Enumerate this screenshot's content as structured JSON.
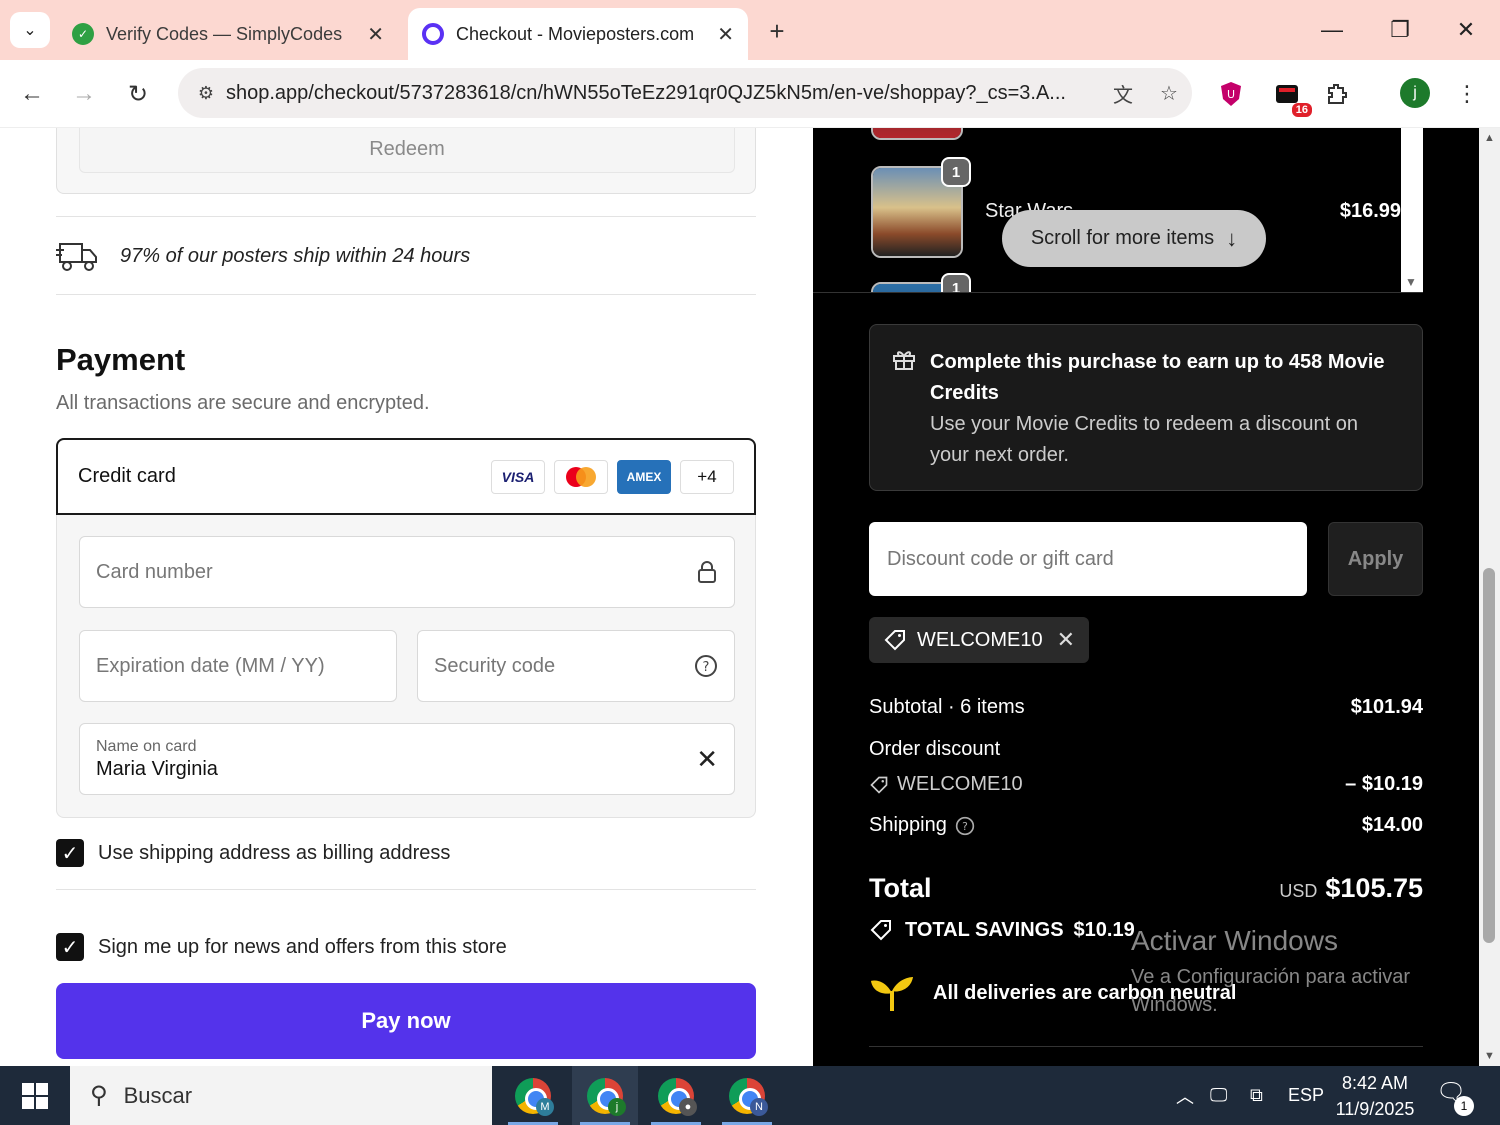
{
  "browser": {
    "tabs": [
      {
        "title": "Verify Codes — SimplyCodes",
        "active": false,
        "favicon": "simplycodes-icon"
      },
      {
        "title": "Checkout - Movieposters.com",
        "active": true,
        "favicon": "shop-icon"
      }
    ],
    "url": "shop.app/checkout/5737283618/cn/hWN55oTeEz291qr0QJZ5kN5m/en-ve/shoppay?_cs=3.A...",
    "extension_badge": "16",
    "profile_initial": "j"
  },
  "checkout": {
    "redeem_label": "Redeem",
    "shipping_note": "97% of our posters ship within 24 hours",
    "payment": {
      "title": "Payment",
      "subtitle": "All transactions are secure and encrypted.",
      "method_label": "Credit card",
      "card_brands": [
        "VISA",
        "",
        "AMEX",
        "+4"
      ],
      "card_number_placeholder": "Card number",
      "expiration_placeholder": "Expiration date (MM / YY)",
      "security_placeholder": "Security code",
      "name_label": "Name on card",
      "name_value": "Maria Virginia"
    },
    "billing_checkbox": {
      "label": "Use shipping address as billing address",
      "checked": true
    },
    "news_checkbox": {
      "label": "Sign me up for news and offers from this store",
      "checked": true
    },
    "pay_button": "Pay now"
  },
  "summary": {
    "items": [
      {
        "name": "Star Wars",
        "price": "$16.99",
        "qty": "1"
      }
    ],
    "next_item_qty": "1",
    "scroll_hint": "Scroll for more items",
    "credits_heading": "Complete this purchase to earn up to 458 Movie Credits",
    "credits_body": "Use your Movie Credits to redeem a discount on your next order.",
    "discount_placeholder": "Discount code or gift card",
    "apply_label": "Apply",
    "applied_code": "WELCOME10",
    "subtotal_label": "Subtotal · 6 items",
    "subtotal_value": "$101.94",
    "order_discount_label": "Order discount",
    "discount_code": "WELCOME10",
    "discount_value": "– $10.19",
    "shipping_label": "Shipping",
    "shipping_value": "$14.00",
    "total_label": "Total",
    "currency": "USD",
    "total_value": "$105.75",
    "savings_label": "TOTAL SAVINGS",
    "savings_value": "$10.19",
    "carbon_note": "All deliveries are carbon neutral"
  },
  "watermark": {
    "line1": "Activar Windows",
    "line2": "Ve a Configuración para activar Windows."
  },
  "taskbar": {
    "search_label": "Buscar",
    "apps": [
      {
        "initial": "M",
        "color": "#2e7d9a"
      },
      {
        "initial": "j",
        "color": "#1d7a2b"
      },
      {
        "initial": "",
        "color": "#555555"
      },
      {
        "initial": "N",
        "color": "#3b5998"
      }
    ],
    "language": "ESP",
    "time": "8:42 AM",
    "date": "11/9/2025",
    "notifications": "1"
  }
}
